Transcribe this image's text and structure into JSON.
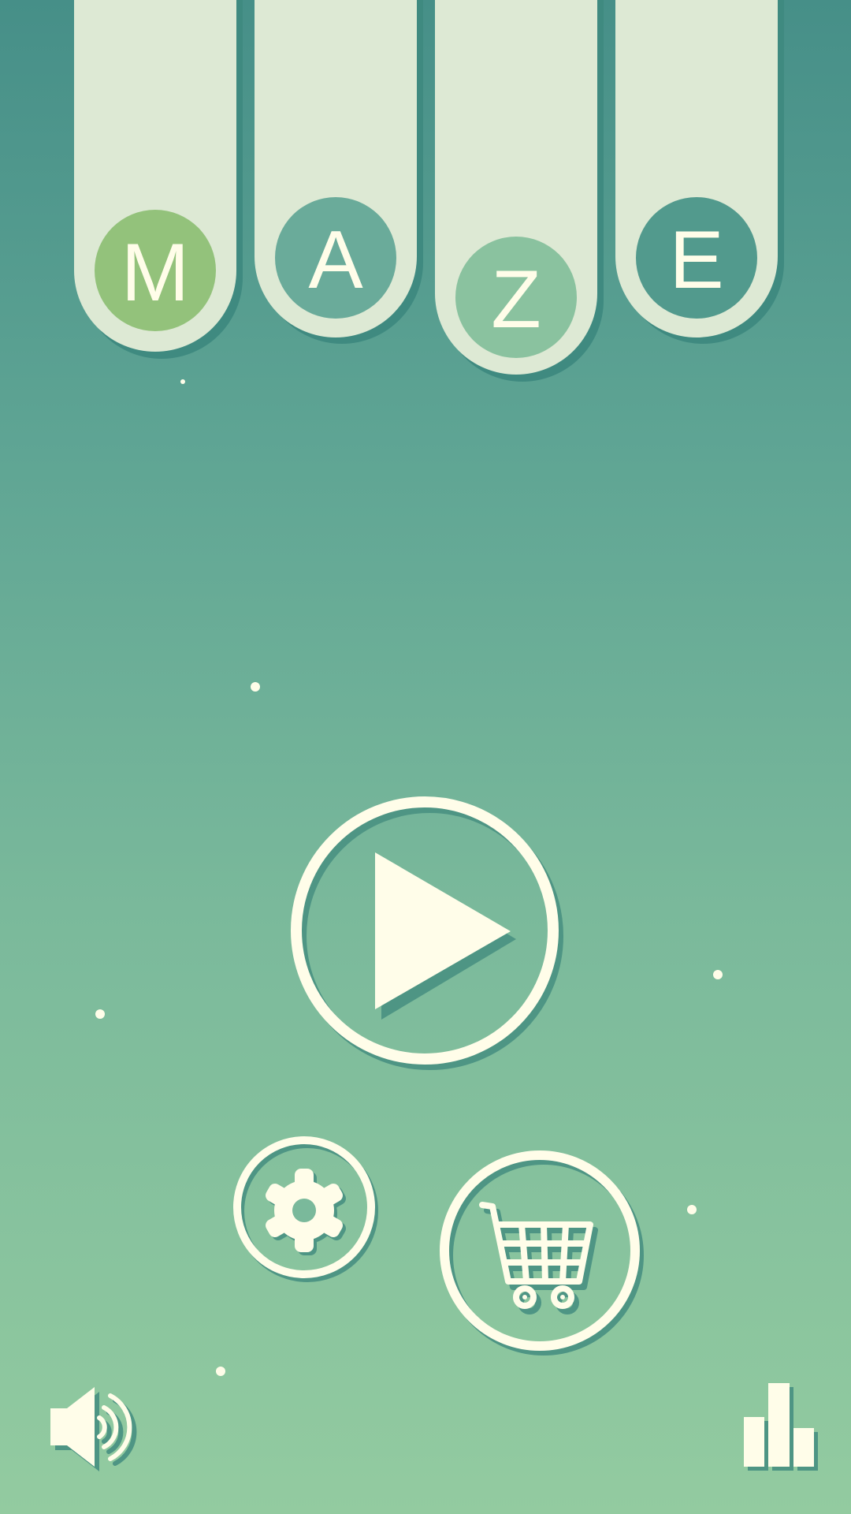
{
  "title": {
    "letters": [
      {
        "char": "M",
        "color": "#93c27b"
      },
      {
        "char": "A",
        "color": "#6aab9a"
      },
      {
        "char": "Z",
        "color": "#8ac29f"
      },
      {
        "char": "E",
        "color": "#529a8d"
      }
    ]
  },
  "buttons": {
    "play": {
      "icon": "play-icon"
    },
    "settings": {
      "icon": "gear-icon"
    },
    "shop": {
      "icon": "cart-icon"
    },
    "sound": {
      "icon": "speaker-icon"
    },
    "leaderboard": {
      "icon": "bar-chart-icon"
    }
  },
  "colors": {
    "cream": "#fffde9",
    "tube": "#dde9d4",
    "shadow": "#3f8a80"
  }
}
